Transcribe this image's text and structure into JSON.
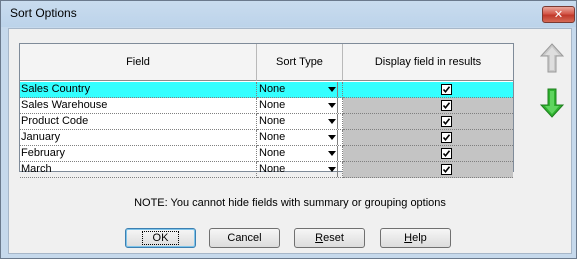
{
  "window": {
    "title": "Sort Options",
    "close_label": "✕"
  },
  "grid": {
    "columns": [
      "Field",
      "Sort Type",
      "Display field in results"
    ],
    "rows": [
      {
        "field": "Sales Country",
        "sort": "None",
        "display": true,
        "selected": true
      },
      {
        "field": "Sales Warehouse",
        "sort": "None",
        "display": true,
        "selected": false
      },
      {
        "field": "Product Code",
        "sort": "None",
        "display": true,
        "selected": false
      },
      {
        "field": "January",
        "sort": "None",
        "display": true,
        "selected": false
      },
      {
        "field": "February",
        "sort": "None",
        "display": true,
        "selected": false
      },
      {
        "field": "March",
        "sort": "None",
        "display": true,
        "selected": false
      }
    ]
  },
  "side_buttons": {
    "up_icon": "arrow-up-icon",
    "down_icon": "arrow-down-icon",
    "up_color": "#b4b4b4",
    "down_color": "#2eb82e"
  },
  "note": "NOTE: You cannot hide fields with summary or grouping options",
  "buttons": {
    "ok": "OK",
    "cancel": "Cancel",
    "reset_pre": "",
    "reset_key": "R",
    "reset_post": "eset",
    "help_pre": "",
    "help_key": "H",
    "help_post": "elp"
  },
  "colors": {
    "selected_row": "#33ffff",
    "display_column": "#c4c4c4"
  }
}
